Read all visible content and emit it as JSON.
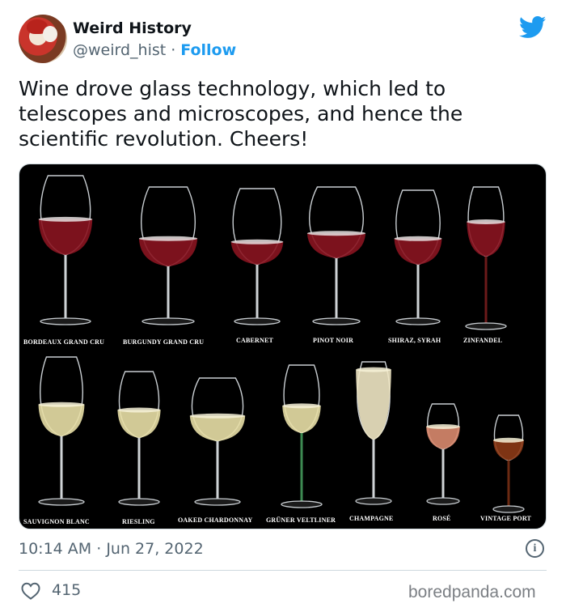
{
  "author": {
    "name": "Weird History",
    "handle": "@weird_hist",
    "separator": "·",
    "follow_label": "Follow"
  },
  "tweet": {
    "text": "Wine drove glass technology, which led to telescopes and microscopes, and hence the scientific revolution. Cheers!"
  },
  "media": {
    "glasses": [
      {
        "label": "BORDEAUX GRAND CRU",
        "wine": "red"
      },
      {
        "label": "BURGUNDY GRAND CRU",
        "wine": "red"
      },
      {
        "label": "CABERNET",
        "wine": "red"
      },
      {
        "label": "PINOT NOIR",
        "wine": "red"
      },
      {
        "label": "SHIRAZ, SYRAH",
        "wine": "red"
      },
      {
        "label": "ZINFANDEL",
        "wine": "red"
      },
      {
        "label": "SAUVIGNON BLANC",
        "wine": "white"
      },
      {
        "label": "RIESLING",
        "wine": "white"
      },
      {
        "label": "OAKED CHARDONNAY",
        "wine": "white"
      },
      {
        "label": "GRÜNER VELTLINER",
        "wine": "white"
      },
      {
        "label": "CHAMPAGNE",
        "wine": "sparkling"
      },
      {
        "label": "ROSÉ",
        "wine": "rose"
      },
      {
        "label": "VINTAGE PORT",
        "wine": "port"
      }
    ]
  },
  "meta": {
    "time": "10:14 AM",
    "separator": "·",
    "date": "Jun 27, 2022"
  },
  "stats": {
    "likes": "415"
  },
  "watermark": "boredpanda.com",
  "colors": {
    "link_blue": "#1d9bf0",
    "muted_gray": "#536471",
    "heart_red": "#f91880"
  }
}
